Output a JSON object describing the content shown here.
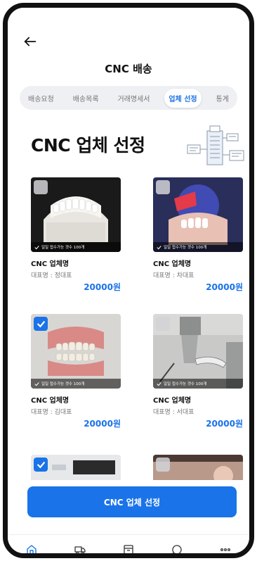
{
  "header": {
    "title": "CNC 배송"
  },
  "tabs": [
    {
      "label": "배송요청",
      "active": false
    },
    {
      "label": "배송목록",
      "active": false
    },
    {
      "label": "거래명세서",
      "active": false
    },
    {
      "label": "업체 선정",
      "active": true
    },
    {
      "label": "통계",
      "active": false
    }
  ],
  "page": {
    "title": "CNC 업체 선정"
  },
  "cards": [
    {
      "name": "CNC 업체명",
      "rep": "대표명 : 정대표",
      "price": "20000원",
      "capacity": "일일 접수가능 갯수 100개",
      "checked": false,
      "image": "dental-white-teeth"
    },
    {
      "name": "CNC 업체명",
      "rep": "대표명 : 차대표",
      "price": "20000원",
      "capacity": "일일 접수가능 갯수 100개",
      "checked": false,
      "image": "dental-blue-light"
    },
    {
      "name": "CNC 업체명",
      "rep": "대표명 : 김대표",
      "price": "20000원",
      "capacity": "일일 접수가능 갯수 100개",
      "checked": true,
      "image": "dental-denture"
    },
    {
      "name": "CNC 업체명",
      "rep": "대표명 : 서대표",
      "price": "20000원",
      "capacity": "일일 접수가능 갯수 100개",
      "checked": false,
      "image": "cnc-machine"
    },
    {
      "checked": true,
      "image": "partial-white"
    },
    {
      "checked": false,
      "image": "partial-pink"
    }
  ],
  "cta": {
    "label": "CNC 업체 선정"
  },
  "nav": [
    {
      "icon": "home-icon",
      "active": true
    },
    {
      "icon": "truck-icon",
      "active": false
    },
    {
      "icon": "box-icon",
      "active": false
    },
    {
      "icon": "chat-icon",
      "active": false
    },
    {
      "icon": "more-icon",
      "active": false
    }
  ],
  "colors": {
    "accent": "#1a73e8",
    "tab_bg": "#eef0f3",
    "text_muted": "#777777"
  }
}
